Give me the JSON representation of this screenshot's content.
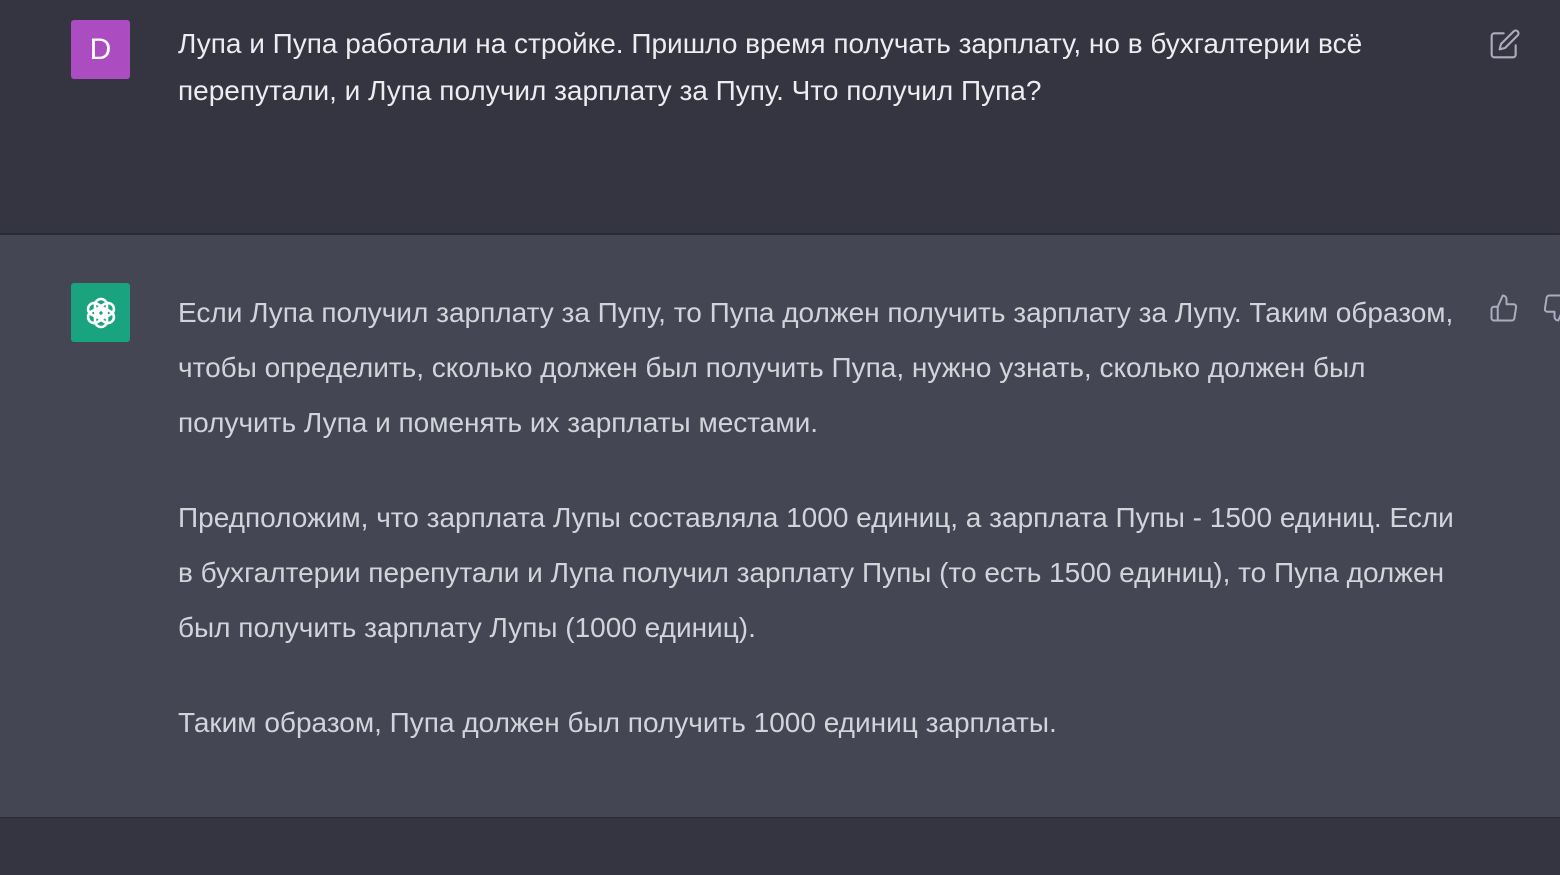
{
  "user_message": {
    "avatar_letter": "D",
    "avatar_color": "#ab4cc1",
    "text": "Лупа и Пупа работали на стройке. Пришло время получать зарплату, но в бухгалтерии всё перепутали, и Лупа получил зарплату за Пупу. Что получил Пупа?",
    "edit_icon": "edit-icon"
  },
  "assistant_message": {
    "avatar_icon": "openai-logo-icon",
    "avatar_color": "#19a37f",
    "paragraphs": [
      "Если Лупа получил зарплату за Пупу, то Пупа должен получить зарплату за Лупу. Таким образом, чтобы определить, сколько должен был получить Пупа, нужно узнать, сколько должен был получить Лупа и поменять их зарплаты местами.",
      "Предположим, что зарплата Лупы составляла 1000 единиц, а зарплата Пупы - 1500 единиц. Если в бухгалтерии перепутали и Лупа получил зарплату Пупы (то есть 1500 единиц), то Пупа должен был получить зарплату Лупы (1000 единиц).",
      "Таким образом, Пупа должен был получить 1000 единиц зарплаты."
    ],
    "like_icon": "thumbs-up-icon",
    "dislike_icon": "thumbs-down-icon"
  }
}
